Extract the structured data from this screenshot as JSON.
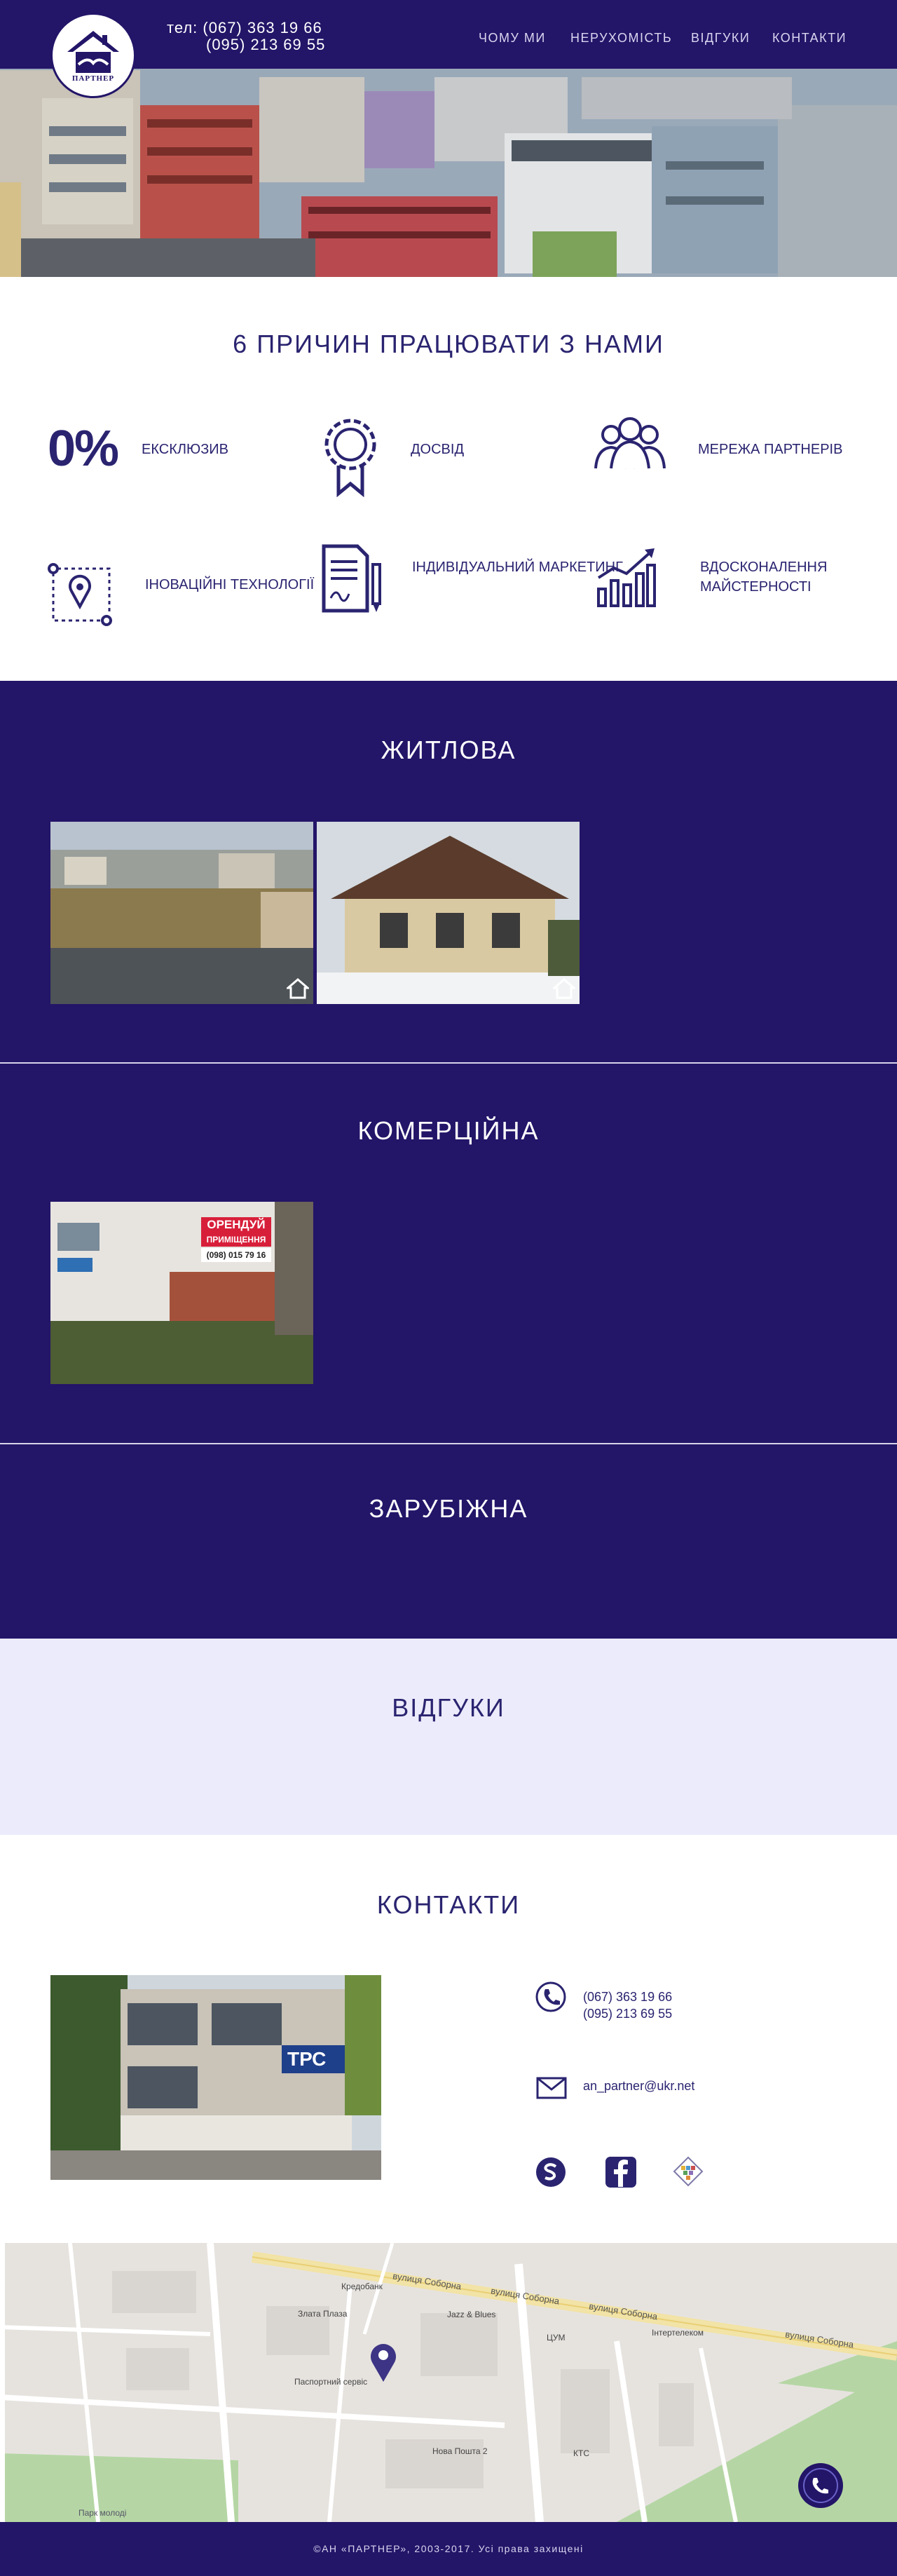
{
  "header": {
    "logo_text": "ПАРТНЕР",
    "phone_1": "тел: (067) 363 19 66",
    "phone_2": "(095) 213 69 55",
    "nav": [
      "ЧОМУ МИ",
      "НЕРУХОМІСТЬ",
      "ВІДГУКИ",
      "КОНТАКТИ"
    ]
  },
  "reasons": {
    "title": "6 ПРИЧИН ПРАЦЮВАТИ З НАМИ",
    "items": [
      {
        "icon": "zero-percent-icon",
        "big": "0%",
        "label": "ЕКСКЛЮЗИВ"
      },
      {
        "icon": "award-ribbon-icon",
        "label": "ДОСВІД"
      },
      {
        "icon": "partners-network-icon",
        "label": "МЕРЕЖА ПАРТНЕРІВ"
      },
      {
        "icon": "map-route-pin-icon",
        "label": "ІНОВАЦІЙНІ ТЕХНОЛОГІЇ"
      },
      {
        "icon": "document-signature-icon",
        "label": "ІНДИВІДУАЛЬНИЙ МАРКЕТИНГ"
      },
      {
        "icon": "growth-chart-icon",
        "label": "ВДОСКОНАЛЕННЯ МАЙСТЕРНОСТІ"
      }
    ]
  },
  "residential": {
    "title": "ЖИТЛОВА"
  },
  "commercial": {
    "title": "КОМЕРЦІЙНА",
    "sign_line_1": "ОРЕНДУЙ",
    "sign_line_2": "ПРИМІЩЕННЯ",
    "sign_phone": "(098) 015 79 16"
  },
  "foreign": {
    "title": "ЗАРУБІЖНА"
  },
  "reviews": {
    "title": "ВІДГУКИ"
  },
  "contacts": {
    "title": "КОНТАКТИ",
    "phone_1": "(067) 363 19 66",
    "phone_2": "(095) 213 69 55",
    "email": "an_partner@ukr.net",
    "building_sign": "ТРС"
  },
  "map": {
    "streets": [
      "вулиця Соборна",
      "вулиця Соборна",
      "вулиця Соборна",
      "вулиця Соборна"
    ],
    "places": [
      "Кредобанк",
      "Злата Плаза",
      "Jazz & Blues",
      "ЦУМ",
      "Інтертелеком",
      "Паспортний сервіс",
      "Нова Пошта 2",
      "КТС",
      "Парк молоді"
    ]
  },
  "footer": {
    "copyright": "©АН «ПАРТНЕР», 2003-2017. Усі права захищені"
  },
  "colors": {
    "brand": "#231568",
    "light_band": "#ecebfb",
    "text": "#2a2470"
  }
}
